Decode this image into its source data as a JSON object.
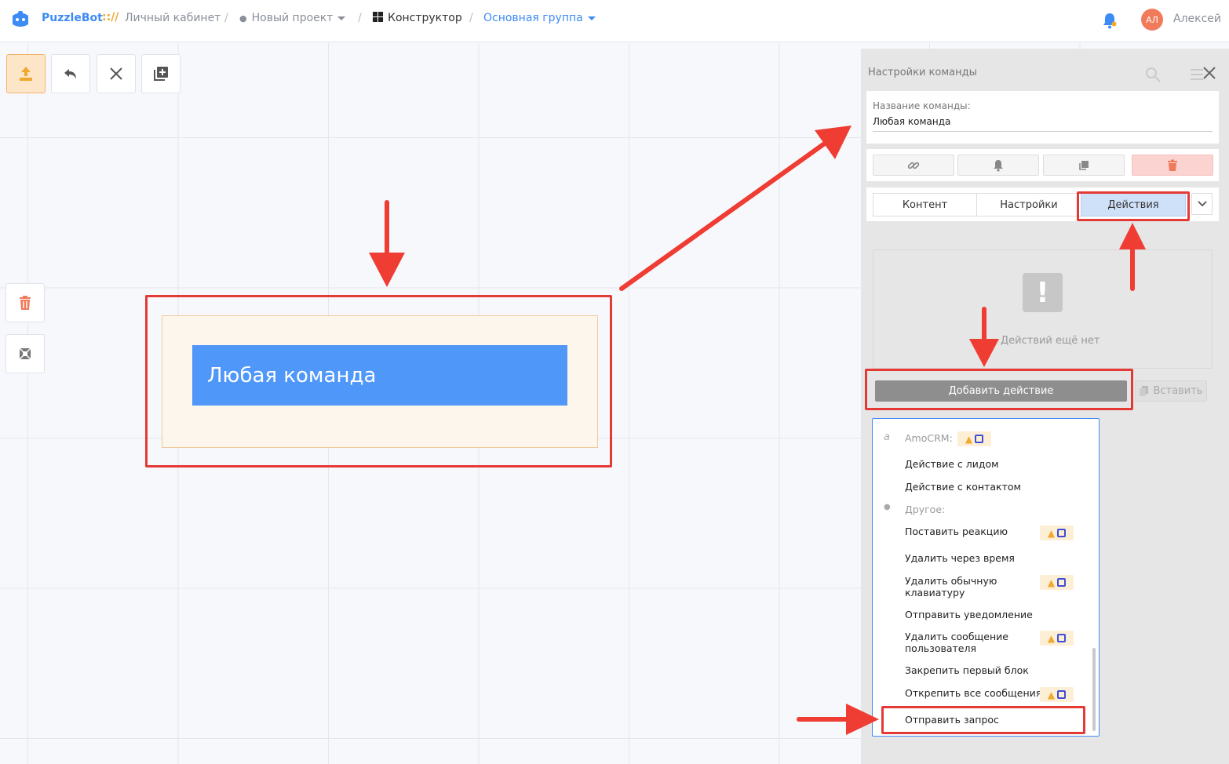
{
  "topbar": {
    "brand": "PuzzleBot",
    "brand_slashes": ":://",
    "crumb_cabinet": "Личный кабинет",
    "crumb_project": "Новый проект",
    "crumb_constructor": "Конструктор",
    "crumb_group": "Основная группа",
    "avatar_initials": "АЛ",
    "username": "Алексей"
  },
  "toolbar": {
    "icons": [
      "upload-icon",
      "undo-icon",
      "close-icon",
      "add-block-icon"
    ]
  },
  "side_tools": {
    "icons": [
      "trash-icon",
      "fit-screen-icon"
    ]
  },
  "block": {
    "title": "Любая команда"
  },
  "panel": {
    "title": "Настройки команды",
    "name_label": "Название команды:",
    "name_value": "Любая команда",
    "icon_buttons": [
      "link-icon",
      "bell-icon",
      "copy-icon",
      "trash-icon"
    ],
    "tabs": [
      "Контент",
      "Настройки",
      "Действия"
    ],
    "active_tab": "Действия",
    "empty_text": "Действий ещё нет",
    "add_action": "Добавить действие",
    "paste": "Вставить"
  },
  "dropdown": {
    "group_amocrm": "AmoCRM:",
    "item_lead": "Действие с лидом",
    "item_contact": "Действие с контактом",
    "group_other": "Другое:",
    "item_reaction": "Поставить реакцию",
    "item_delete_time": "Удалить через время",
    "item_delete_kb_1": "Удалить обычную",
    "item_delete_kb_2": "клавиатуру",
    "item_notify": "Отправить уведомление",
    "item_delete_msg_1": "Удалить сообщение",
    "item_delete_msg_2": "пользователя",
    "item_pin_first": "Закрепить первый блок",
    "item_unpin_all": "Открепить все сообщения",
    "item_send_request": "Отправить запрос"
  },
  "colors": {
    "accent": "#3d8bf5",
    "block_blue": "#4f97f8",
    "highlight_red": "#e53935",
    "orange": "#f0a830"
  }
}
